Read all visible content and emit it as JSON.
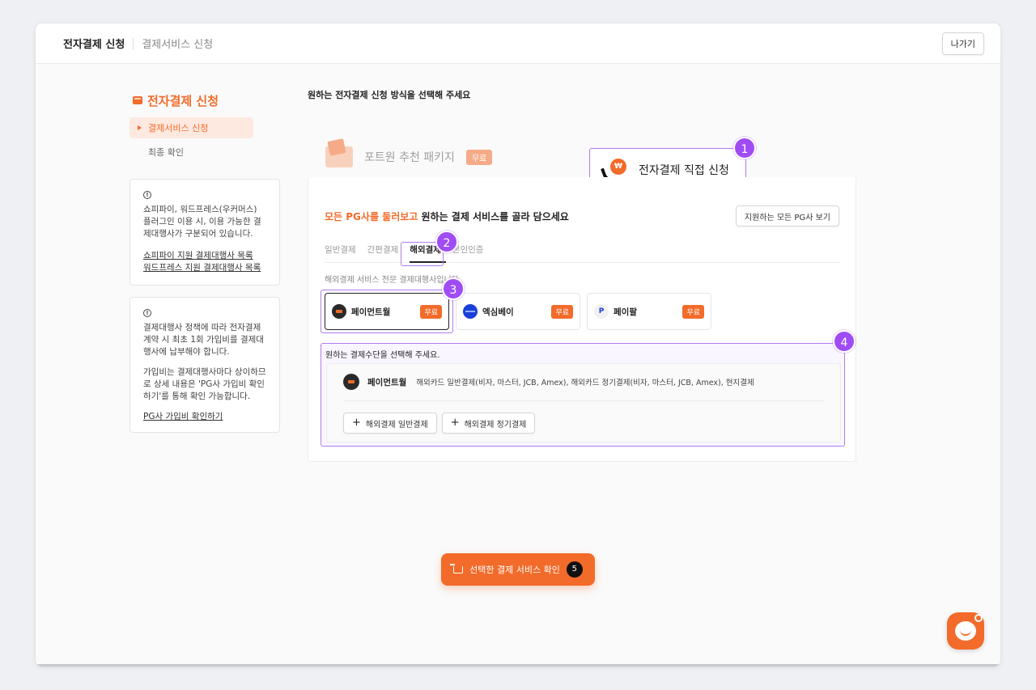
{
  "topbar": {
    "title": "전자결제 신청",
    "subtitle": "결제서비스 신청",
    "exit_label": "나가기"
  },
  "sidebar": {
    "title": "전자결제 신청",
    "items": [
      {
        "label": "결제서비스 신청",
        "active": true
      },
      {
        "label": "최종 확인",
        "active": false
      }
    ],
    "info_card_1": {
      "text": "쇼피파이, 워드프레스(우커머스) 플러그인 이용 시, 이용 가능한 결제대행사가 구분되어 있습니다.",
      "link_1": "쇼피파이 지원 결제대행사 목록",
      "link_2": "워드프레스 지원 결제대행사 목록"
    },
    "info_card_2": {
      "text_1": "결제대행사 정책에 따라 전자결제 계약 시 최초 1회 가입비를 결제대행사에 납부해야 합니다.",
      "text_2": "가입비는 결제대행사마다 상이하므로 상세 내용은 'PG사 가입비 확인하기'를 통해 확인 가능합니다.",
      "link": "PG사 가입비 확인하기"
    }
  },
  "main": {
    "heading": "원하는 전자결제 신청 방식을 선택해 주세요",
    "tabs": [
      {
        "label": "포트원 추천 패키지",
        "badge": "무료",
        "active": false
      },
      {
        "label": "전자결제 직접 신청",
        "active": true
      }
    ],
    "panel": {
      "heading_accent": "모든 PG사를 둘러보고",
      "heading_rest": " 원하는 결제 서비스를 골라 담으세요",
      "all_pg_button": "지원하는 모든 PG사 보기",
      "subtabs": [
        "일반결제",
        "간편결제",
        "해외결제",
        "본인인증"
      ],
      "active_subtab": "해외결제",
      "description": "해외결제 서비스 전문 결제대행사입니다.",
      "pg_cards": [
        {
          "name": "페이먼트월",
          "badge": "무료",
          "selected": true,
          "logo": "paymentwall-logo"
        },
        {
          "name": "엑심베이",
          "badge": "무료",
          "selected": false,
          "logo": "eximbay-logo"
        },
        {
          "name": "페이팔",
          "badge": "무료",
          "selected": false,
          "logo": "paypal-logo"
        }
      ],
      "select_hint": "원하는 결제수단을 선택해 주세요.",
      "selected_pg": {
        "name": "페이먼트월",
        "description": "해외카드 일반결제(비자, 마스터, JCB, Amex), 해외카드 정기결제(비자, 마스터, JCB, Amex), 현지결제",
        "buttons": [
          "해외결제 일반결제",
          "해외결제 정기결제"
        ]
      }
    }
  },
  "steps": [
    "1",
    "2",
    "3",
    "4"
  ],
  "confirm": {
    "label": "선택한 결제 서비스 확인",
    "count": "5"
  },
  "colors": {
    "accent": "#f26b2a",
    "highlight": "#a04cf5"
  }
}
